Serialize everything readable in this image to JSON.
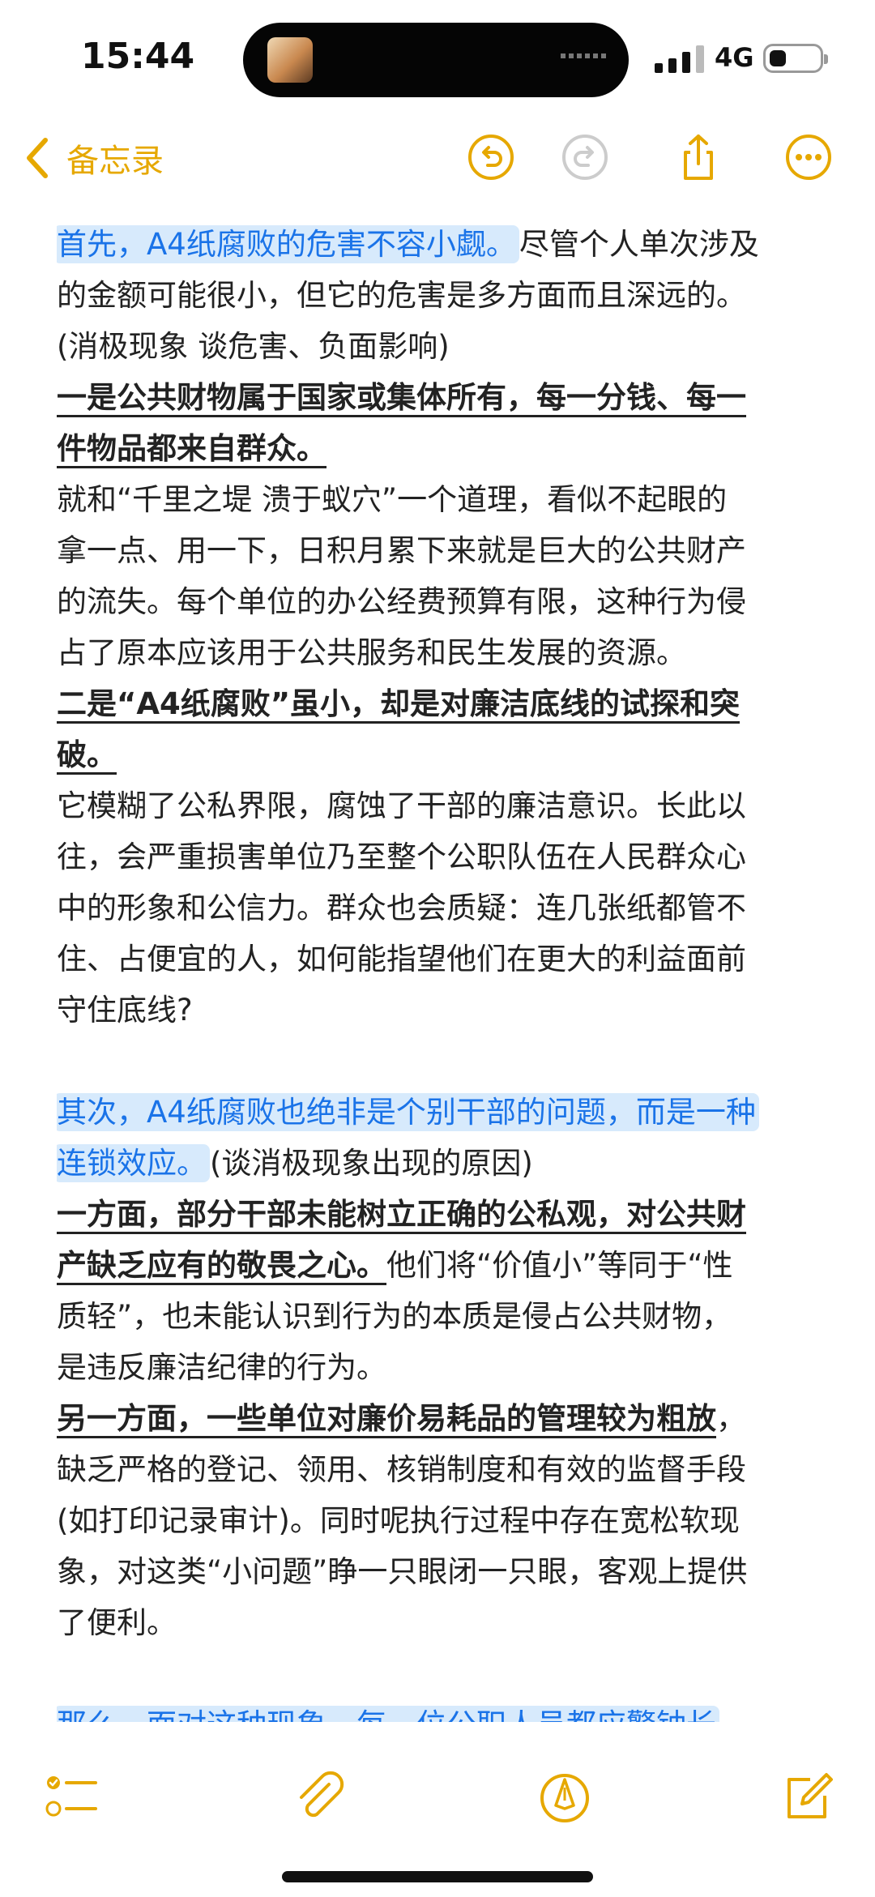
{
  "status_bar": {
    "time": "15:44",
    "network": "4G"
  },
  "nav": {
    "back_label": "备忘录"
  },
  "colors": {
    "accent": "#e6a800",
    "highlight_text": "#1a73e8",
    "highlight_bg": "#d7eafc"
  },
  "icons": {
    "back": "chevron-left-icon",
    "undo": "undo-icon",
    "redo": "redo-icon",
    "share": "share-icon",
    "more": "more-icon",
    "checklist": "checklist-icon",
    "attach": "paperclip-icon",
    "markup": "pen-tip-icon",
    "compose": "compose-icon"
  },
  "note": {
    "lines": [
      {
        "segments": [
          {
            "text": "首先，A4纸腐败的危害不容小觑。",
            "style": "hl"
          },
          {
            "text": "尽管个人单次涉及"
          }
        ]
      },
      {
        "segments": [
          {
            "text": "的金额可能很小，但它的危害是多方面而且深远的。"
          }
        ]
      },
      {
        "segments": [
          {
            "text": "(消极现象 谈危害、负面影响)"
          }
        ]
      },
      {
        "segments": [
          {
            "text": "一是公共财物属于国家或集体所有，每一分钱、每一",
            "style": "bold"
          }
        ]
      },
      {
        "segments": [
          {
            "text": "件物品都来自群众。",
            "style": "bold"
          }
        ]
      },
      {
        "segments": [
          {
            "text": "就和“千里之堤 溃于蚁穴”一个道理，看似不起眼的"
          }
        ]
      },
      {
        "segments": [
          {
            "text": "拿一点、用一下，日积月累下来就是巨大的公共财产"
          }
        ]
      },
      {
        "segments": [
          {
            "text": "的流失。每个单位的办公经费预算有限，这种行为侵"
          }
        ]
      },
      {
        "segments": [
          {
            "text": "占了原本应该用于公共服务和民生发展的资源。"
          }
        ]
      },
      {
        "segments": [
          {
            "text": "二是“A4纸腐败”虽小，却是对廉洁底线的试探和突",
            "style": "bold"
          }
        ]
      },
      {
        "segments": [
          {
            "text": "破。",
            "style": "bold"
          }
        ]
      },
      {
        "segments": [
          {
            "text": "它模糊了公私界限，腐蚀了干部的廉洁意识。长此以"
          }
        ]
      },
      {
        "segments": [
          {
            "text": "往，会严重损害单位乃至整个公职队伍在人民群众心"
          }
        ]
      },
      {
        "segments": [
          {
            "text": "中的形象和公信力。群众也会质疑：连几张纸都管不"
          }
        ]
      },
      {
        "segments": [
          {
            "text": "住、占便宜的人，如何能指望他们在更大的利益面前"
          }
        ]
      },
      {
        "segments": [
          {
            "text": "守住底线?"
          }
        ]
      },
      {
        "segments": []
      },
      {
        "segments": [
          {
            "text": "其次，A4纸腐败也绝非是个别干部的问题，而是一种",
            "style": "hl"
          }
        ]
      },
      {
        "segments": [
          {
            "text": "连锁效应。",
            "style": "hl"
          },
          {
            "text": "(谈消极现象出现的原因)"
          }
        ]
      },
      {
        "segments": [
          {
            "text": "一方面，部分干部未能树立正确的公私观，对公共财",
            "style": "bold"
          }
        ]
      },
      {
        "segments": [
          {
            "text": "产缺乏应有的敬畏之心。",
            "style": "bold"
          },
          {
            "text": "他们将“价值小”等同于“性"
          }
        ]
      },
      {
        "segments": [
          {
            "text": "质轻”，也未能认识到行为的本质是侵占公共财物，"
          }
        ]
      },
      {
        "segments": [
          {
            "text": "是违反廉洁纪律的行为。"
          }
        ]
      },
      {
        "segments": [
          {
            "text": "另一方面，一些单位对廉价易耗品的管理较为粗放",
            "style": "bold"
          },
          {
            "text": "，"
          }
        ]
      },
      {
        "segments": [
          {
            "text": "缺乏严格的登记、领用、核销制度和有效的监督手段"
          }
        ]
      },
      {
        "segments": [
          {
            "text": "(如打印记录审计)。同时呢执行过程中存在宽松软现"
          }
        ]
      },
      {
        "segments": [
          {
            "text": "象，对这类“小问题”睁一只眼闭一只眼，客观上提供"
          }
        ]
      },
      {
        "segments": [
          {
            "text": "了便利。"
          }
        ]
      },
      {
        "segments": []
      },
      {
        "segments": [
          {
            "text": "那么，面对这种现象，每一位公职人员都应警钟长",
            "style": "hl"
          }
        ]
      }
    ]
  }
}
